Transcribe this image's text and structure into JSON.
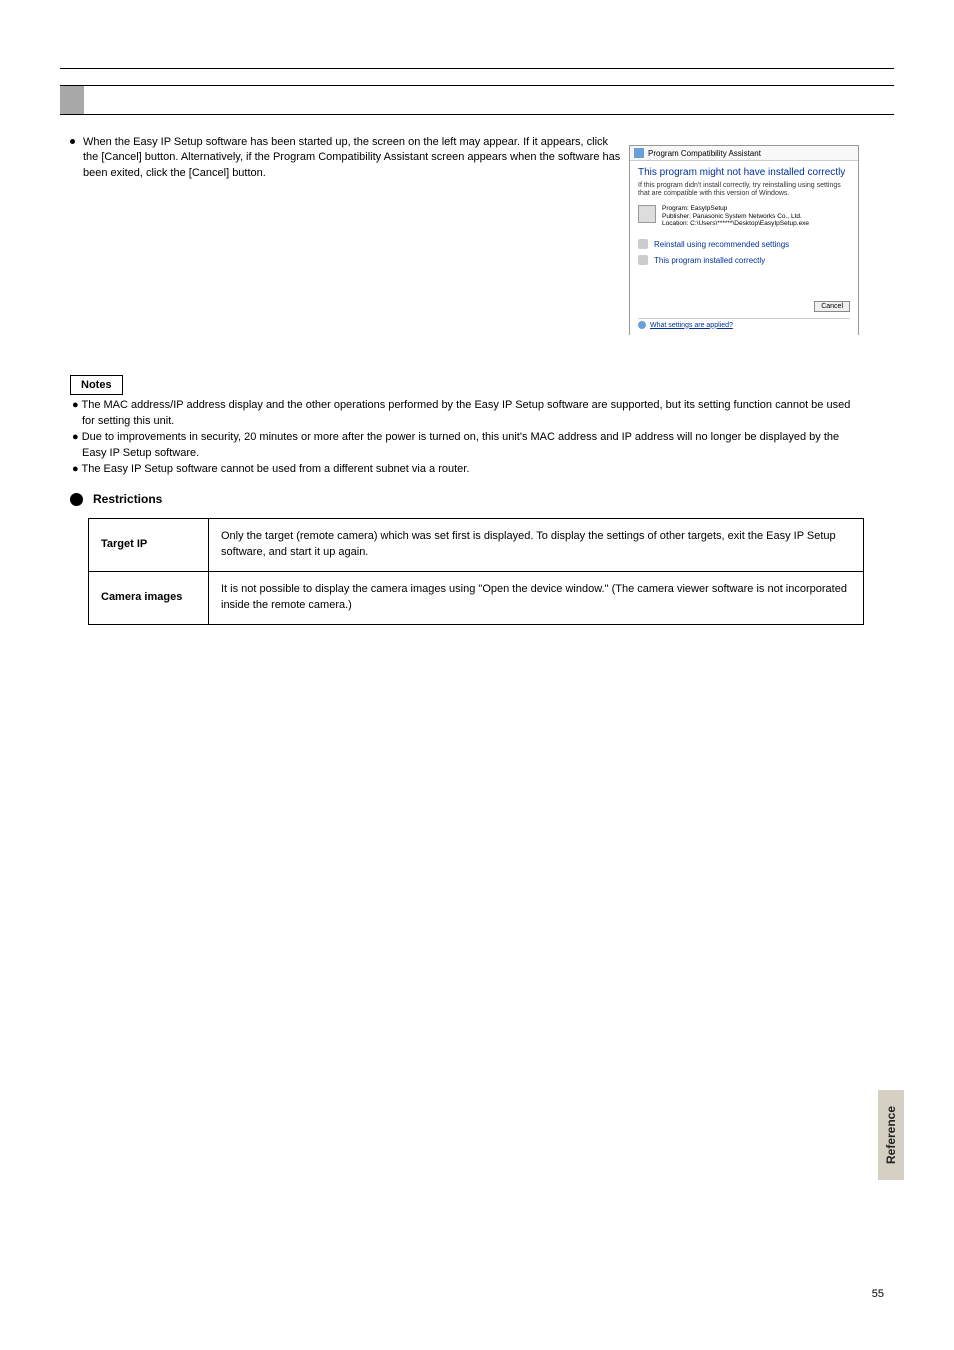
{
  "section_header": "",
  "bullet1": "When the Easy IP Setup software has been started up, the screen on the left may appear. If it appears, click the [Cancel] button. Alternatively, if the Program Compatibility Assistant screen appears when the software has been exited, click the [Cancel] button.",
  "screenshot": {
    "title": "Program Compatibility Assistant",
    "heading": "This program might not have installed correctly",
    "sub": "If this program didn't install correctly, try reinstalling using settings that are compatible with this version of Windows.",
    "program_label": "Program: EasyIpSetup",
    "publisher_label": "Publisher: Panasonic System Networks Co., Ltd.",
    "location_label": "Location: C:\\Users\\******\\Desktop\\EasyIpSetup.exe",
    "opt1": "Reinstall using recommended settings",
    "opt2": "This program installed correctly",
    "cancel": "Cancel",
    "foot": "What settings are applied?"
  },
  "notes_title": "Notes",
  "note_a": "● The MAC address/IP address display and the other operations performed by the Easy IP Setup software are supported, but its setting function cannot be used for setting this unit.",
  "note_b": "● Due to improvements in security, 20 minutes or more after the power is turned on, this unit's MAC address and IP address will no longer be displayed by the Easy IP Setup software.",
  "note_c": "● The Easy IP Setup software cannot be used from a different subnet via a router.",
  "restrictions_heading": "Restrictions",
  "table": {
    "r1c1": "Target IP",
    "r1c2": "Only the target (remote camera) which was set first is displayed. To display the settings of other targets, exit the Easy IP Setup software, and start it up again.",
    "r2c1": "Camera images",
    "r2c2": "It is not possible to display the camera images using \"Open the device window.\" (The camera viewer software is not incorporated inside the remote camera.)"
  },
  "side_tab": "Reference",
  "page_number": "55"
}
